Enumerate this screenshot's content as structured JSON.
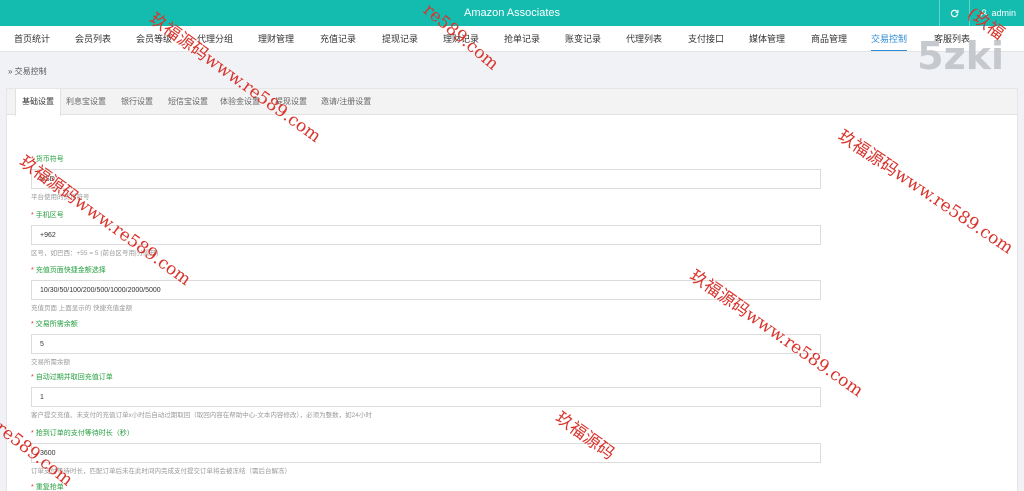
{
  "topbar": {
    "title": "Amazon Associates",
    "refresh_icon": "refresh-icon",
    "user_icon": "user-icon",
    "user_label": "admin"
  },
  "menu": [
    {
      "label": "首页统计"
    },
    {
      "label": "会员列表"
    },
    {
      "label": "会员等级"
    },
    {
      "label": "代理分组"
    },
    {
      "label": "理财管理"
    },
    {
      "label": "充值记录"
    },
    {
      "label": "提现记录"
    },
    {
      "label": "理财记录"
    },
    {
      "label": "抢单记录"
    },
    {
      "label": "账变记录"
    },
    {
      "label": "代理列表"
    },
    {
      "label": "支付接口"
    },
    {
      "label": "媒体管理"
    },
    {
      "label": "商品管理"
    },
    {
      "label": "交易控制",
      "active": true
    },
    {
      "label": "客服列表"
    }
  ],
  "breadcrumb": "» 交易控制",
  "tabs": [
    {
      "label": "基础设置",
      "active": true
    },
    {
      "label": "利息宝设置"
    },
    {
      "label": "银行设置"
    },
    {
      "label": "短信宝设置"
    },
    {
      "label": "体验金设置"
    },
    {
      "label": "提现设置"
    },
    {
      "label": "邀请/注册设置"
    }
  ],
  "fields": [
    {
      "label": "货币符号",
      "value": "USD",
      "hint": "平台使用的货币符号"
    },
    {
      "label": "手机区号",
      "value": "+962",
      "hint": "区号，如巴西：+55 = 5 (前台区号用|分隔开)"
    },
    {
      "label": "充值页面快捷金额选择",
      "value": "10/30/50/100/200/500/1000/2000/5000",
      "hint": "充值页面 上面显示的 快捷充值金额"
    },
    {
      "label": "交易所需余额",
      "value": "5",
      "hint": "交易所需余额"
    },
    {
      "label": "自动过期并取回充值订单",
      "value": "1",
      "hint": "客户提交充值、未支付的充值订单x小时后自动过期取回（取回内容在帮助中心-文本内容修改），必须为整数，如24小时"
    },
    {
      "label": "抢到订单的支付等待时长（秒）",
      "value": "3600",
      "hint": "订单支付等待时长，匹配订单后未在此时间内完成支付提交订单将会被冻结（需后台解冻）"
    },
    {
      "label": "重复抢单",
      "value": "",
      "hint": ""
    }
  ],
  "watermarks": {
    "main": "玖福源码www.re589.com",
    "part_a": "re589.com",
    "part_b": "玖福源码",
    "part_c": "(玖福",
    "corner": "5zki"
  },
  "colors": {
    "topbar": "#14bcb0",
    "active_menu": "#2e8bd6",
    "label_green": "#1f9e3a",
    "required_red": "#e12f2f",
    "watermark_red": "#d8342c"
  }
}
